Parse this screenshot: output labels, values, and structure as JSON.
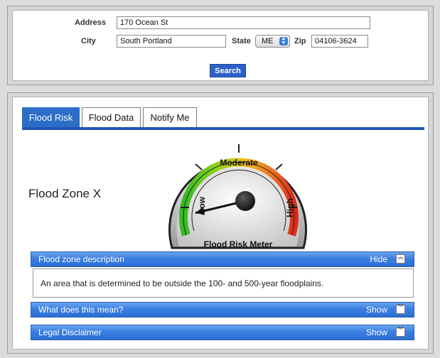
{
  "search": {
    "address_label": "Address",
    "address_value": "170 Ocean St",
    "city_label": "City",
    "city_value": "South Portland",
    "state_label": "State",
    "state_value": "ME",
    "zip_label": "Zip",
    "zip_value": "04106-3624",
    "search_button": "Search"
  },
  "tabs": [
    {
      "label": "Flood Risk",
      "active": true
    },
    {
      "label": "Flood Data",
      "active": false
    },
    {
      "label": "Notify Me",
      "active": false
    }
  ],
  "zone": {
    "title": "Flood Zone X"
  },
  "meter": {
    "label_low": "Low",
    "label_moderate": "Moderate",
    "label_high": "High",
    "caption": "Flood Risk Meter",
    "level": 0.05
  },
  "sections": [
    {
      "title": "Flood zone description",
      "toggle": "Hide",
      "chevron": "collapse-icon"
    },
    {
      "title": "What does this mean?",
      "toggle": "Show",
      "chevron": "expand-icon"
    },
    {
      "title": "Legal Disclaimer",
      "toggle": "Show",
      "chevron": "expand-icon"
    }
  ],
  "description": "An area that is determined to be outside the 100- and 500-year floodplains.",
  "colors": {
    "tab_active": "#2c6dc8",
    "button": "#2d60c8",
    "bar": "#3a7fe0",
    "low": "#33bb22",
    "moderate": "#f0c020",
    "high": "#e02a1a"
  }
}
